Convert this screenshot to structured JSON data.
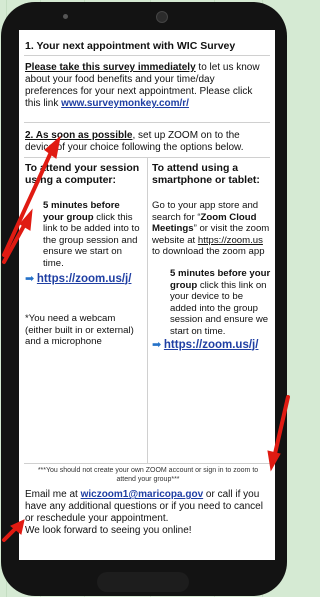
{
  "page": {
    "heading": "1. Your next appointment with WIC Survey",
    "survey": {
      "lead": "Please take this survey immediately",
      "body": " to let us know about your food benefits and your time/day preferences for your next appointment. Please click this link ",
      "link": "www.surveymonkey.com/r/"
    },
    "step2": {
      "lead": "2. As soon as possible",
      "body": ", set up ZOOM on to the device of your choice following the options below."
    },
    "computer": {
      "heading": "To attend your session using a computer:",
      "bold": "5 minutes before your group",
      "body": " click this link to be added into to the group session and ensure we start on time.",
      "link": "https://zoom.us/j/",
      "note": "*You need a webcam (either built in or external) and a microphone"
    },
    "phone": {
      "heading": "To attend using a smartphone or tablet:",
      "p1_start": "Go to your app store and search for “",
      "p1_bold": "Zoom Cloud Meetings",
      "p1_mid": "” or visit the zoom website at ",
      "p1_link": "https://zoom.us",
      "p1_end": " to download the zoom app",
      "bold": "5 minutes before your group",
      "body": " click this link on your device to be added into the group session and ensure we start on time.",
      "link": "https://zoom.us/j/"
    },
    "footnote": "***You should not create your own ZOOM account or sign in to zoom to attend your group***",
    "email": {
      "start": "Email me at ",
      "link": "wiczoom1@maricopa.gov",
      "end": " or call if you have any additional questions or if you need to cancel or reschedule your appointment.",
      "closing": "We look forward to seeing you online!"
    }
  },
  "colors": {
    "background": "#d5ead3",
    "phone": "#131313",
    "link": "#1f3fa3",
    "pointer": "#e01b12",
    "bullet": "#2471c8"
  },
  "icons": {
    "bullet": "arrow-right-icon",
    "pointer": "red-pointer-arrow-icon"
  }
}
